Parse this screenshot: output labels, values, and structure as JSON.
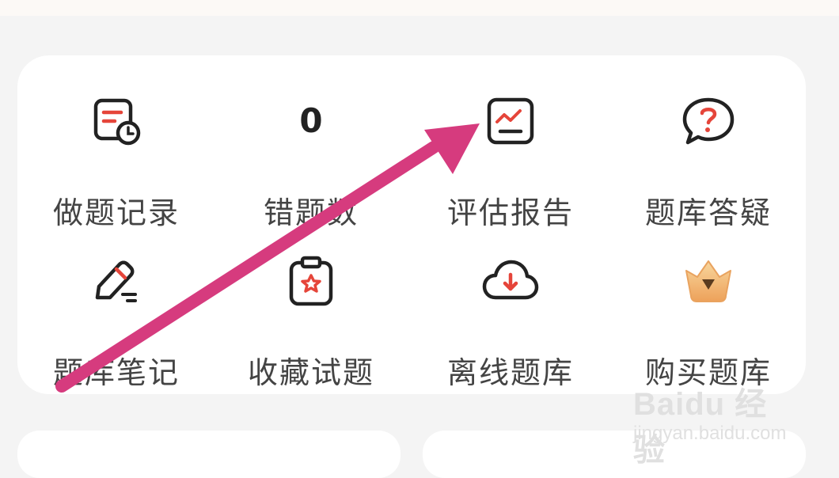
{
  "menu": {
    "row1": [
      {
        "label": "做题记录",
        "icon": "record-clock-icon"
      },
      {
        "label": "错题数",
        "count": "0"
      },
      {
        "label": "评估报告",
        "icon": "chart-report-icon"
      },
      {
        "label": "题库答疑",
        "icon": "question-bubble-icon"
      }
    ],
    "row2": [
      {
        "label": "题库笔记",
        "icon": "pencil-note-icon"
      },
      {
        "label": "收藏试题",
        "icon": "clipboard-star-icon"
      },
      {
        "label": "离线题库",
        "icon": "cloud-download-icon"
      },
      {
        "label": "购买题库",
        "icon": "crown-icon"
      }
    ]
  },
  "watermark": {
    "logo": "Baidu 经验",
    "url": "jingyan.baidu.com"
  },
  "colors": {
    "accent": "#e5453a",
    "arrow": "#d63b7e",
    "crown": "#f3b36a"
  }
}
